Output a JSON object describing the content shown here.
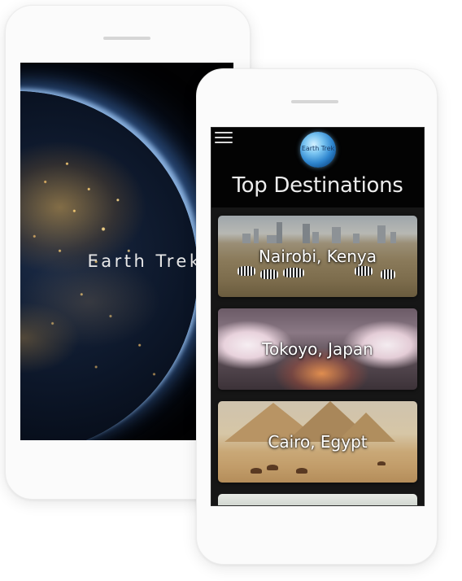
{
  "splash": {
    "title": "Earth Trek"
  },
  "app": {
    "logo_text": "Earth Trek",
    "page_title": "Top Destinations",
    "destinations": [
      {
        "label": "Nairobi, Kenya"
      },
      {
        "label": "Tokoyo, Japan"
      },
      {
        "label": "Cairo, Egypt"
      }
    ]
  },
  "icons": {
    "menu": "hamburger-menu-icon",
    "logo": "globe-logo-icon"
  },
  "colors": {
    "header_bg": "#030303",
    "screen_bg": "#161616",
    "text": "#ececec",
    "logo_blue": "#2f86cf"
  }
}
